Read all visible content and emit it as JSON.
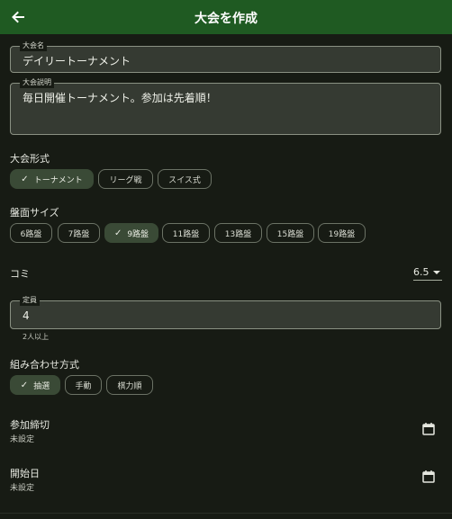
{
  "appbar": {
    "title": "大会を作成",
    "back_icon": "arrow-left-icon"
  },
  "name_field": {
    "label": "大会名",
    "value": "デイリートーナメント"
  },
  "description_field": {
    "label": "大会説明",
    "value": "毎日開催トーナメント。参加は先着順！"
  },
  "format": {
    "label": "大会形式",
    "options": [
      "トーナメント",
      "リーグ戦",
      "スイス式"
    ],
    "selected": "トーナメント"
  },
  "board_size": {
    "label": "盤面サイズ",
    "options": [
      "6路盤",
      "7路盤",
      "9路盤",
      "11路盤",
      "13路盤",
      "15路盤",
      "19路盤"
    ],
    "selected": "9路盤"
  },
  "komi": {
    "label": "コミ",
    "value": "6.5"
  },
  "capacity_field": {
    "label": "定員",
    "value": "4",
    "helper": "2人以上"
  },
  "pairing": {
    "label": "組み合わせ方式",
    "options": [
      "抽選",
      "手動",
      "棋力順"
    ],
    "selected": "抽選"
  },
  "deadline": {
    "title": "参加締切",
    "value": "未設定",
    "icon": "calendar-icon"
  },
  "start_date": {
    "title": "開始日",
    "value": "未設定",
    "icon": "calendar-icon"
  },
  "colors": {
    "appbar": "#1f5a22",
    "background": "#171b14",
    "chip_selected": "#3a4a36"
  }
}
